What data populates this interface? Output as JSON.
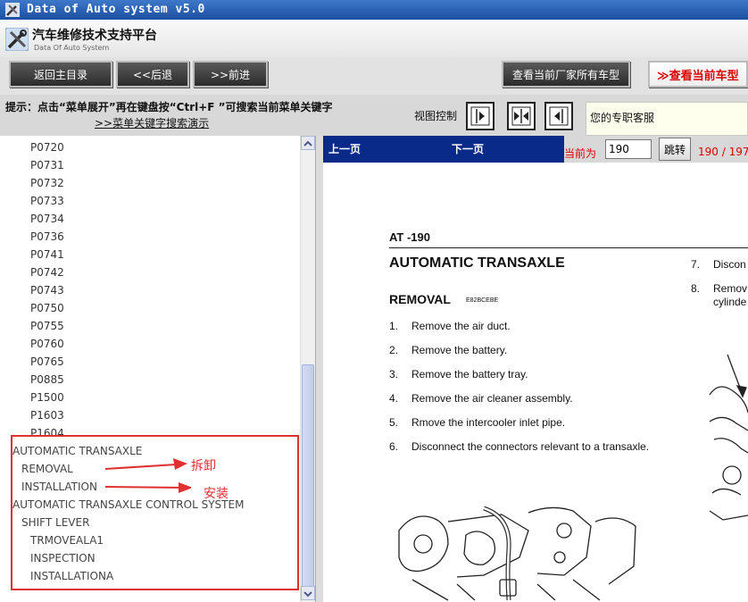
{
  "window": {
    "title": "Data of Auto system v5.0"
  },
  "header": {
    "app_name": "汽车维修技术支持平台",
    "app_subtitle": "Data Of Auto System"
  },
  "toolbar": {
    "home_label": "返回主目录",
    "back_label": "<<后退",
    "forward_label": ">>前进",
    "all_models_label": "查看当前厂家所有车型",
    "current_model_label": "≫查看当前车型"
  },
  "hint": {
    "text": "提示：点击“菜单展开”再在键盘按“Ctrl+F ”可搜索当前菜单关键字",
    "link": ">>菜单关键字搜索演示"
  },
  "view_control": {
    "label": "视图控制",
    "support_text": "您的专职客服"
  },
  "left_panel": {
    "codes": [
      "P0720",
      "P0731",
      "P0732",
      "P0733",
      "P0734",
      "P0736",
      "P0741",
      "P0742",
      "P0743",
      "P0750",
      "P0755",
      "P0760",
      "P0765",
      "P0885",
      "P1500",
      "P1603",
      "P1604"
    ],
    "tree": [
      {
        "label": "AUTOMATIC TRANSAXLE",
        "level": 0
      },
      {
        "label": "REMOVAL",
        "level": 1
      },
      {
        "label": "INSTALLATION",
        "level": 1
      },
      {
        "label": "AUTOMATIC TRANSAXLE CONTROL SYSTEM",
        "level": 0
      },
      {
        "label": "SHIFT LEVER",
        "level": 1
      },
      {
        "label": "TRMOVEALA1",
        "level": 2
      },
      {
        "label": "INSPECTION",
        "level": 2
      },
      {
        "label": "INSTALLATIONA",
        "level": 2
      }
    ],
    "annotations": {
      "removal": "拆卸",
      "installation": "安装"
    }
  },
  "nav": {
    "prev_label": "上一页",
    "next_label": "下一页",
    "current_label": "当前为",
    "page_value": "190",
    "jump_label": "跳转",
    "page_count": "190 / 197"
  },
  "document": {
    "page_header": "AT -190",
    "title": "AUTOMATIC TRANSAXLE",
    "section": "REMOVAL",
    "section_code": "E82BCEBE",
    "steps": [
      {
        "num": "1.",
        "text": "Remove the air duct."
      },
      {
        "num": "2.",
        "text": "Remove the battery."
      },
      {
        "num": "3.",
        "text": "Remove the battery tray."
      },
      {
        "num": "4.",
        "text": "Remove the air cleaner assembly."
      },
      {
        "num": "5.",
        "text": "Rmove the intercooler inlet pipe."
      },
      {
        "num": "6.",
        "text": "Disconnect the connectors relevant to a transaxle."
      }
    ],
    "right_steps": [
      {
        "num": "7.",
        "text": "Discon"
      },
      {
        "num": "8.",
        "text": "Remov"
      },
      {
        "num": "",
        "text": "cylinde"
      }
    ]
  },
  "colors": {
    "accent_red": "#e03030",
    "nav_blue": "#0a2a8a"
  }
}
